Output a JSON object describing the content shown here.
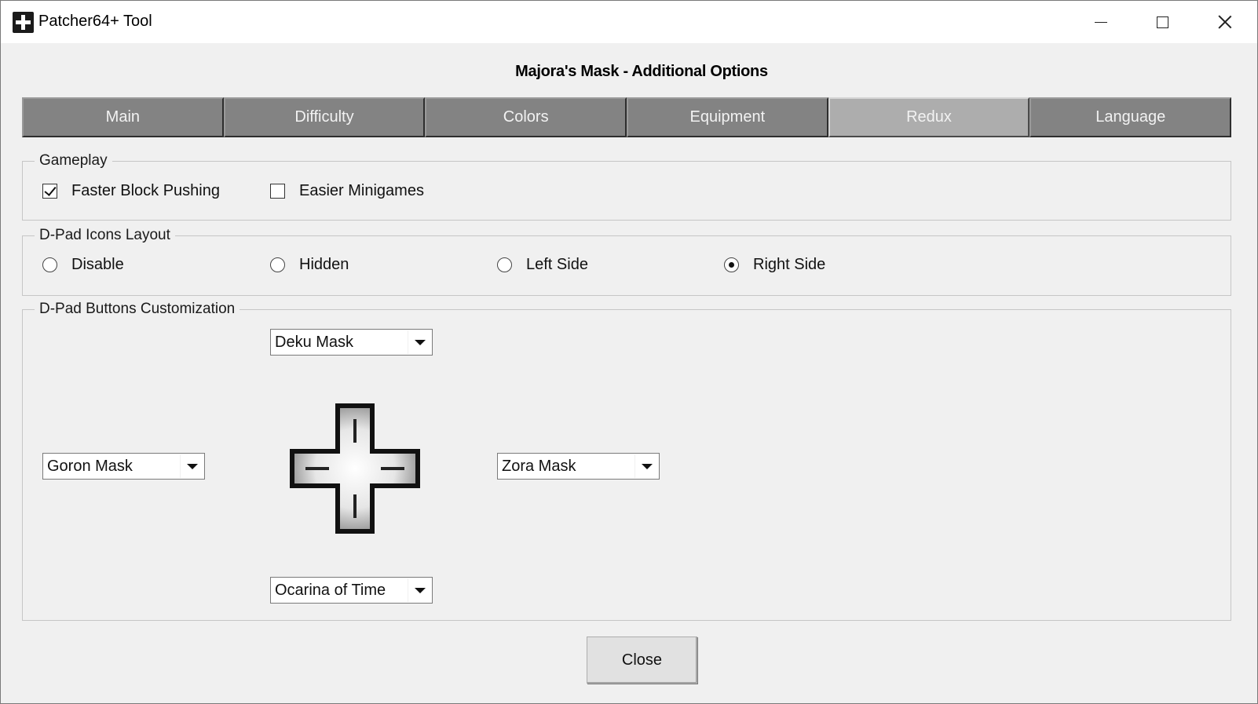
{
  "window": {
    "title": "Patcher64+ Tool",
    "heading": "Majora's Mask - Additional Options"
  },
  "tabs": [
    {
      "label": "Main",
      "active": false
    },
    {
      "label": "Difficulty",
      "active": false
    },
    {
      "label": "Colors",
      "active": false
    },
    {
      "label": "Equipment",
      "active": false
    },
    {
      "label": "Redux",
      "active": true
    },
    {
      "label": "Language",
      "active": false
    }
  ],
  "gameplay": {
    "legend": "Gameplay",
    "options": [
      {
        "label": "Faster Block Pushing",
        "checked": true
      },
      {
        "label": "Easier Minigames",
        "checked": false
      }
    ]
  },
  "dpad_layout": {
    "legend": "D-Pad Icons Layout",
    "options": [
      {
        "label": "Disable",
        "selected": false
      },
      {
        "label": "Hidden",
        "selected": false
      },
      {
        "label": "Left Side",
        "selected": false
      },
      {
        "label": "Right Side",
        "selected": true
      }
    ]
  },
  "dpad_buttons": {
    "legend": "D-Pad Buttons Customization",
    "up": "Deku Mask",
    "left": "Goron Mask",
    "right": "Zora Mask",
    "down": "Ocarina of Time"
  },
  "footer": {
    "close_label": "Close"
  },
  "icons": {
    "app": "patcher64-plus-icon",
    "dpad": "dpad-cross-icon"
  }
}
